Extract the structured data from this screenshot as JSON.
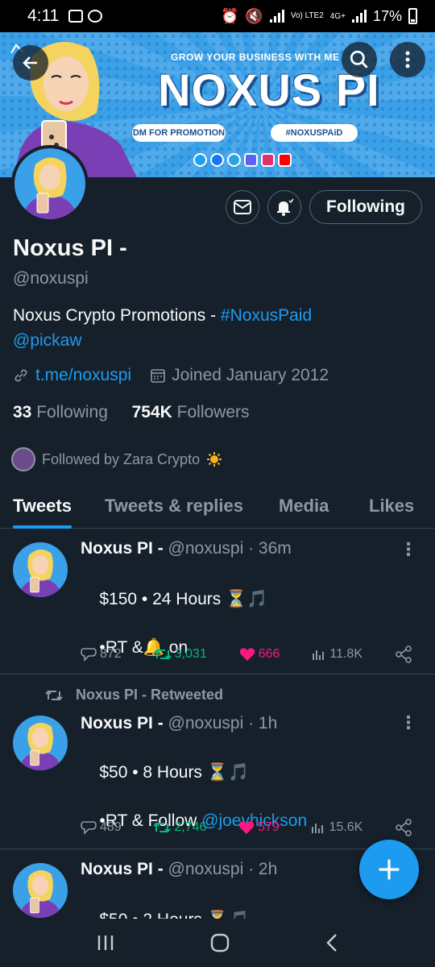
{
  "status_bar": {
    "time": "4:11",
    "network": "Vo) LTE2",
    "net_type": "4G+",
    "battery": "17%"
  },
  "banner": {
    "tagline": "GROW YOUR BUSINESS WITH ME",
    "brand": "NOXUS PI",
    "dm_pill": "DM FOR PROMOTION",
    "tag_pill": "#NOXUSPAiD"
  },
  "profile": {
    "name": "Noxus PI -",
    "handle": "@noxuspi",
    "bio_text": "Noxus Crypto Promotions - ",
    "bio_hashtag": "#NoxusPaid",
    "bio_mention": "@pickaw",
    "website": "t.me/noxuspi",
    "joined": "Joined January 2012",
    "following_count": "33",
    "following_label": "Following",
    "followers_count": "754K",
    "followers_label": "Followers",
    "followed_by": "Followed by Zara Crypto",
    "follow_button": "Following"
  },
  "tabs": [
    "Tweets",
    "Tweets & replies",
    "Media",
    "Likes"
  ],
  "tweets": [
    {
      "name": "Noxus PI -",
      "handle": "@noxuspi",
      "time": "36m",
      "line1": "$150 • 24 Hours",
      "line2": "•RT &",
      "line2_suffix": "on",
      "replies": "872",
      "retweets": "3,031",
      "likes": "666",
      "views": "11.8K"
    },
    {
      "retweet_label": "Noxus PI - Retweeted",
      "name": "Noxus PI -",
      "handle": "@noxuspi",
      "time": "1h",
      "line1": "$50 • 8 Hours",
      "line2": "•RT & Follow ",
      "line2_mention": "@joeyhickson",
      "replies": "489",
      "retweets": "2,746",
      "likes": "579",
      "views": "15.6K"
    },
    {
      "name": "Noxus PI -",
      "handle": "@noxuspi",
      "time": "2h",
      "line1": "$50 • 2 Hours"
    }
  ],
  "colors": {
    "background": "#15202b",
    "accent": "#1d9bf0",
    "retweet": "#00ba7c",
    "like": "#f91880",
    "muted": "#8b98a5"
  }
}
